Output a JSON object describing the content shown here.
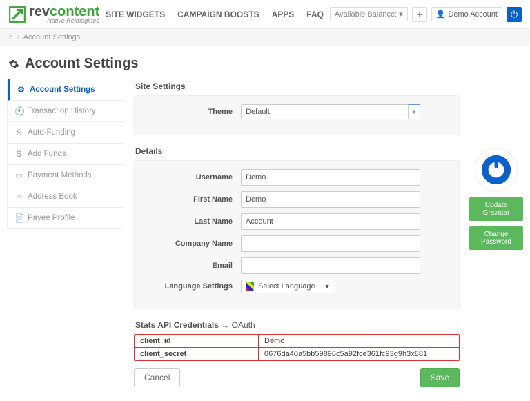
{
  "header": {
    "logo_text_pre": "rev",
    "logo_text_post": "content",
    "logo_sub": "Native Reimagined",
    "nav": [
      "SITE WIDGETS",
      "CAMPAIGN BOOSTS",
      "APPS",
      "FAQ"
    ],
    "balance_label": "Available Balance:",
    "balance_caret": "▾",
    "plus": "+",
    "account_label": "Demo Account",
    "power": "⏻"
  },
  "breadcrumb": {
    "home": "⌂",
    "current": "Account Settings"
  },
  "page_title": "Account Settings",
  "sidebar": {
    "items": [
      {
        "icon": "⚙",
        "label": "Account Settings"
      },
      {
        "icon": "🕘",
        "label": "Transaction History"
      },
      {
        "icon": "$",
        "label": "Auto-Funding"
      },
      {
        "icon": "$",
        "label": "Add Funds"
      },
      {
        "icon": "▭",
        "label": "Payment Methods"
      },
      {
        "icon": "⌂",
        "label": "Address Book"
      },
      {
        "icon": "📄",
        "label": "Payee Profile"
      }
    ]
  },
  "site_settings": {
    "title": "Site Settings",
    "theme_label": "Theme",
    "theme_value": "Default"
  },
  "details": {
    "title": "Details",
    "username_label": "Username",
    "username_value": "Demo",
    "first_label": "First Name",
    "first_value": "Demo",
    "last_label": "Last Name",
    "last_value": "Account",
    "company_label": "Company Name",
    "company_value": "",
    "email_label": "Email",
    "email_value": "",
    "lang_label": "Language Settings",
    "lang_value": "Select Language",
    "lang_caret": "▼"
  },
  "oauth": {
    "title_pre": "Stats API Credentials",
    "title_sep": "→",
    "title_post": "OAuth",
    "client_id_label": "client_id",
    "client_id_value": "Demo",
    "client_secret_label": "client_secret",
    "client_secret_value": "0676da40a5bb59896c5a92fce361fc93g9h3x881"
  },
  "footer": {
    "cancel": "Cancel",
    "save": "Save"
  },
  "right": {
    "update": "Update Gravatar",
    "change": "Change Password"
  }
}
